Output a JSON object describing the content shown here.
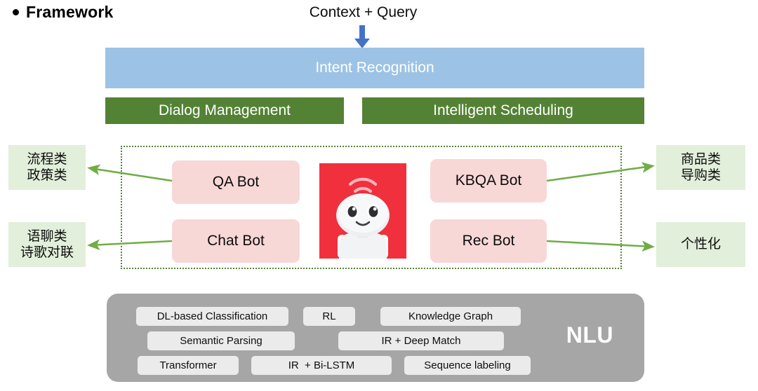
{
  "header": {
    "bullet": "bullet-dot",
    "title": "Framework"
  },
  "flow": {
    "input_label": "Context + Query",
    "input_arrow_icon": "down-arrow-icon",
    "intent_bar": "Intent Recognition",
    "management_bars": [
      "Dialog Management",
      "Intelligent Scheduling"
    ]
  },
  "bots": {
    "qa": "QA Bot",
    "chat": "Chat Bot",
    "kbqa": "KBQA Bot",
    "rec": "Rec Bot",
    "mascot_icon": "robot-mascot-icon"
  },
  "categories": {
    "left": [
      {
        "line1": "流程类",
        "line2": "政策类"
      },
      {
        "line1": "语聊类",
        "line2": "诗歌对联"
      }
    ],
    "right": [
      {
        "line1": "商品类",
        "line2": "导购类"
      },
      {
        "line1": "个性化",
        "line2": ""
      }
    ]
  },
  "nlu": {
    "label": "NLU",
    "chips": [
      "DL-based Classification",
      "RL",
      "Knowledge Graph",
      "Semantic Parsing",
      "IR + Deep Match",
      "Transformer",
      "IR  + Bi-LSTM",
      "Sequence labeling"
    ]
  },
  "colors": {
    "intent_blue": "#9CC3E5",
    "bar_green": "#548235",
    "bot_pink": "#F8D7D7",
    "category_green": "#E2EFDA",
    "arrow_green": "#70AD47",
    "arrow_blue": "#4472C4",
    "nlu_gray": "#A6A6A6",
    "chip_gray": "#EBEBEB",
    "mascot_red": "#F0303C"
  }
}
